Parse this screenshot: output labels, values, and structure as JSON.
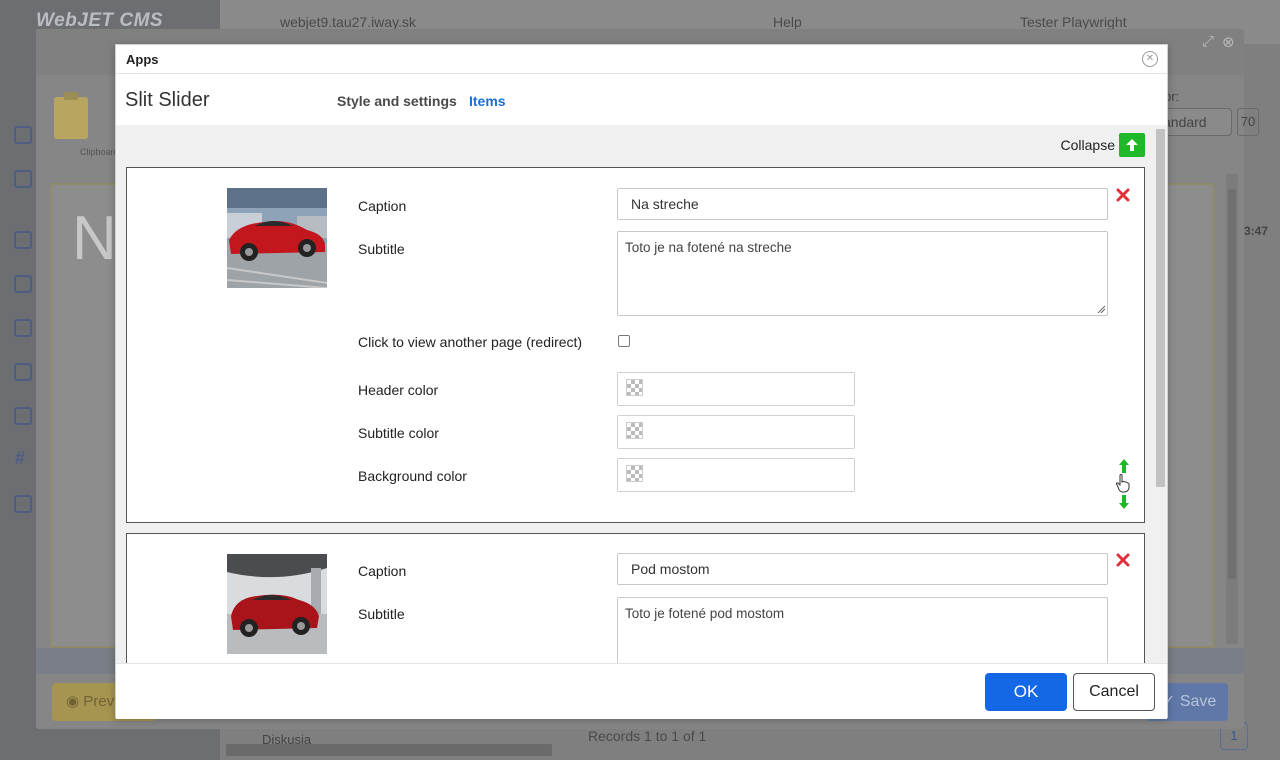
{
  "background": {
    "logo_text": "WebJET CMS",
    "domain": "webjet9.tau27.iway.sk",
    "help_label": "Help",
    "user_name": "Tester Playwright",
    "records_text": "Records 1 to 1 of 1",
    "page_number": "1",
    "tree_item": "Diskusia"
  },
  "editor": {
    "clipboard_label": "Clipboard",
    "canvas_letter": "N",
    "preview_label": "Prev",
    "save_label": "Save",
    "right_label": "or:",
    "right_select": "andard",
    "right_number": "70",
    "time_text": "3:47"
  },
  "dialog": {
    "title": "Apps",
    "app_name": "Slit Slider",
    "tabs": [
      {
        "label": "Style and settings",
        "active": false
      },
      {
        "label": "Items",
        "active": true
      }
    ],
    "collapse_label": "Collapse",
    "items": [
      {
        "image_alt": "red car on a rooftop parking",
        "caption_label": "Caption",
        "caption_value": "Na streche",
        "subtitle_label": "Subtitle",
        "subtitle_value": "Toto je na fotené na streche",
        "redirect_label": "Click to view another page (redirect)",
        "redirect_checked": false,
        "header_color_label": "Header color",
        "subtitle_color_label": "Subtitle color",
        "background_color_label": "Background color"
      },
      {
        "image_alt": "red car under a bridge",
        "caption_label": "Caption",
        "caption_value": "Pod mostom",
        "subtitle_label": "Subtitle",
        "subtitle_value": "Toto je fotené pod mostom"
      }
    ],
    "ok_label": "OK",
    "cancel_label": "Cancel"
  },
  "colors": {
    "primary_blue": "#1468e6",
    "active_tab": "#1a6fd6",
    "collapse_green": "#1fb829",
    "delete_red": "#e0313b"
  }
}
